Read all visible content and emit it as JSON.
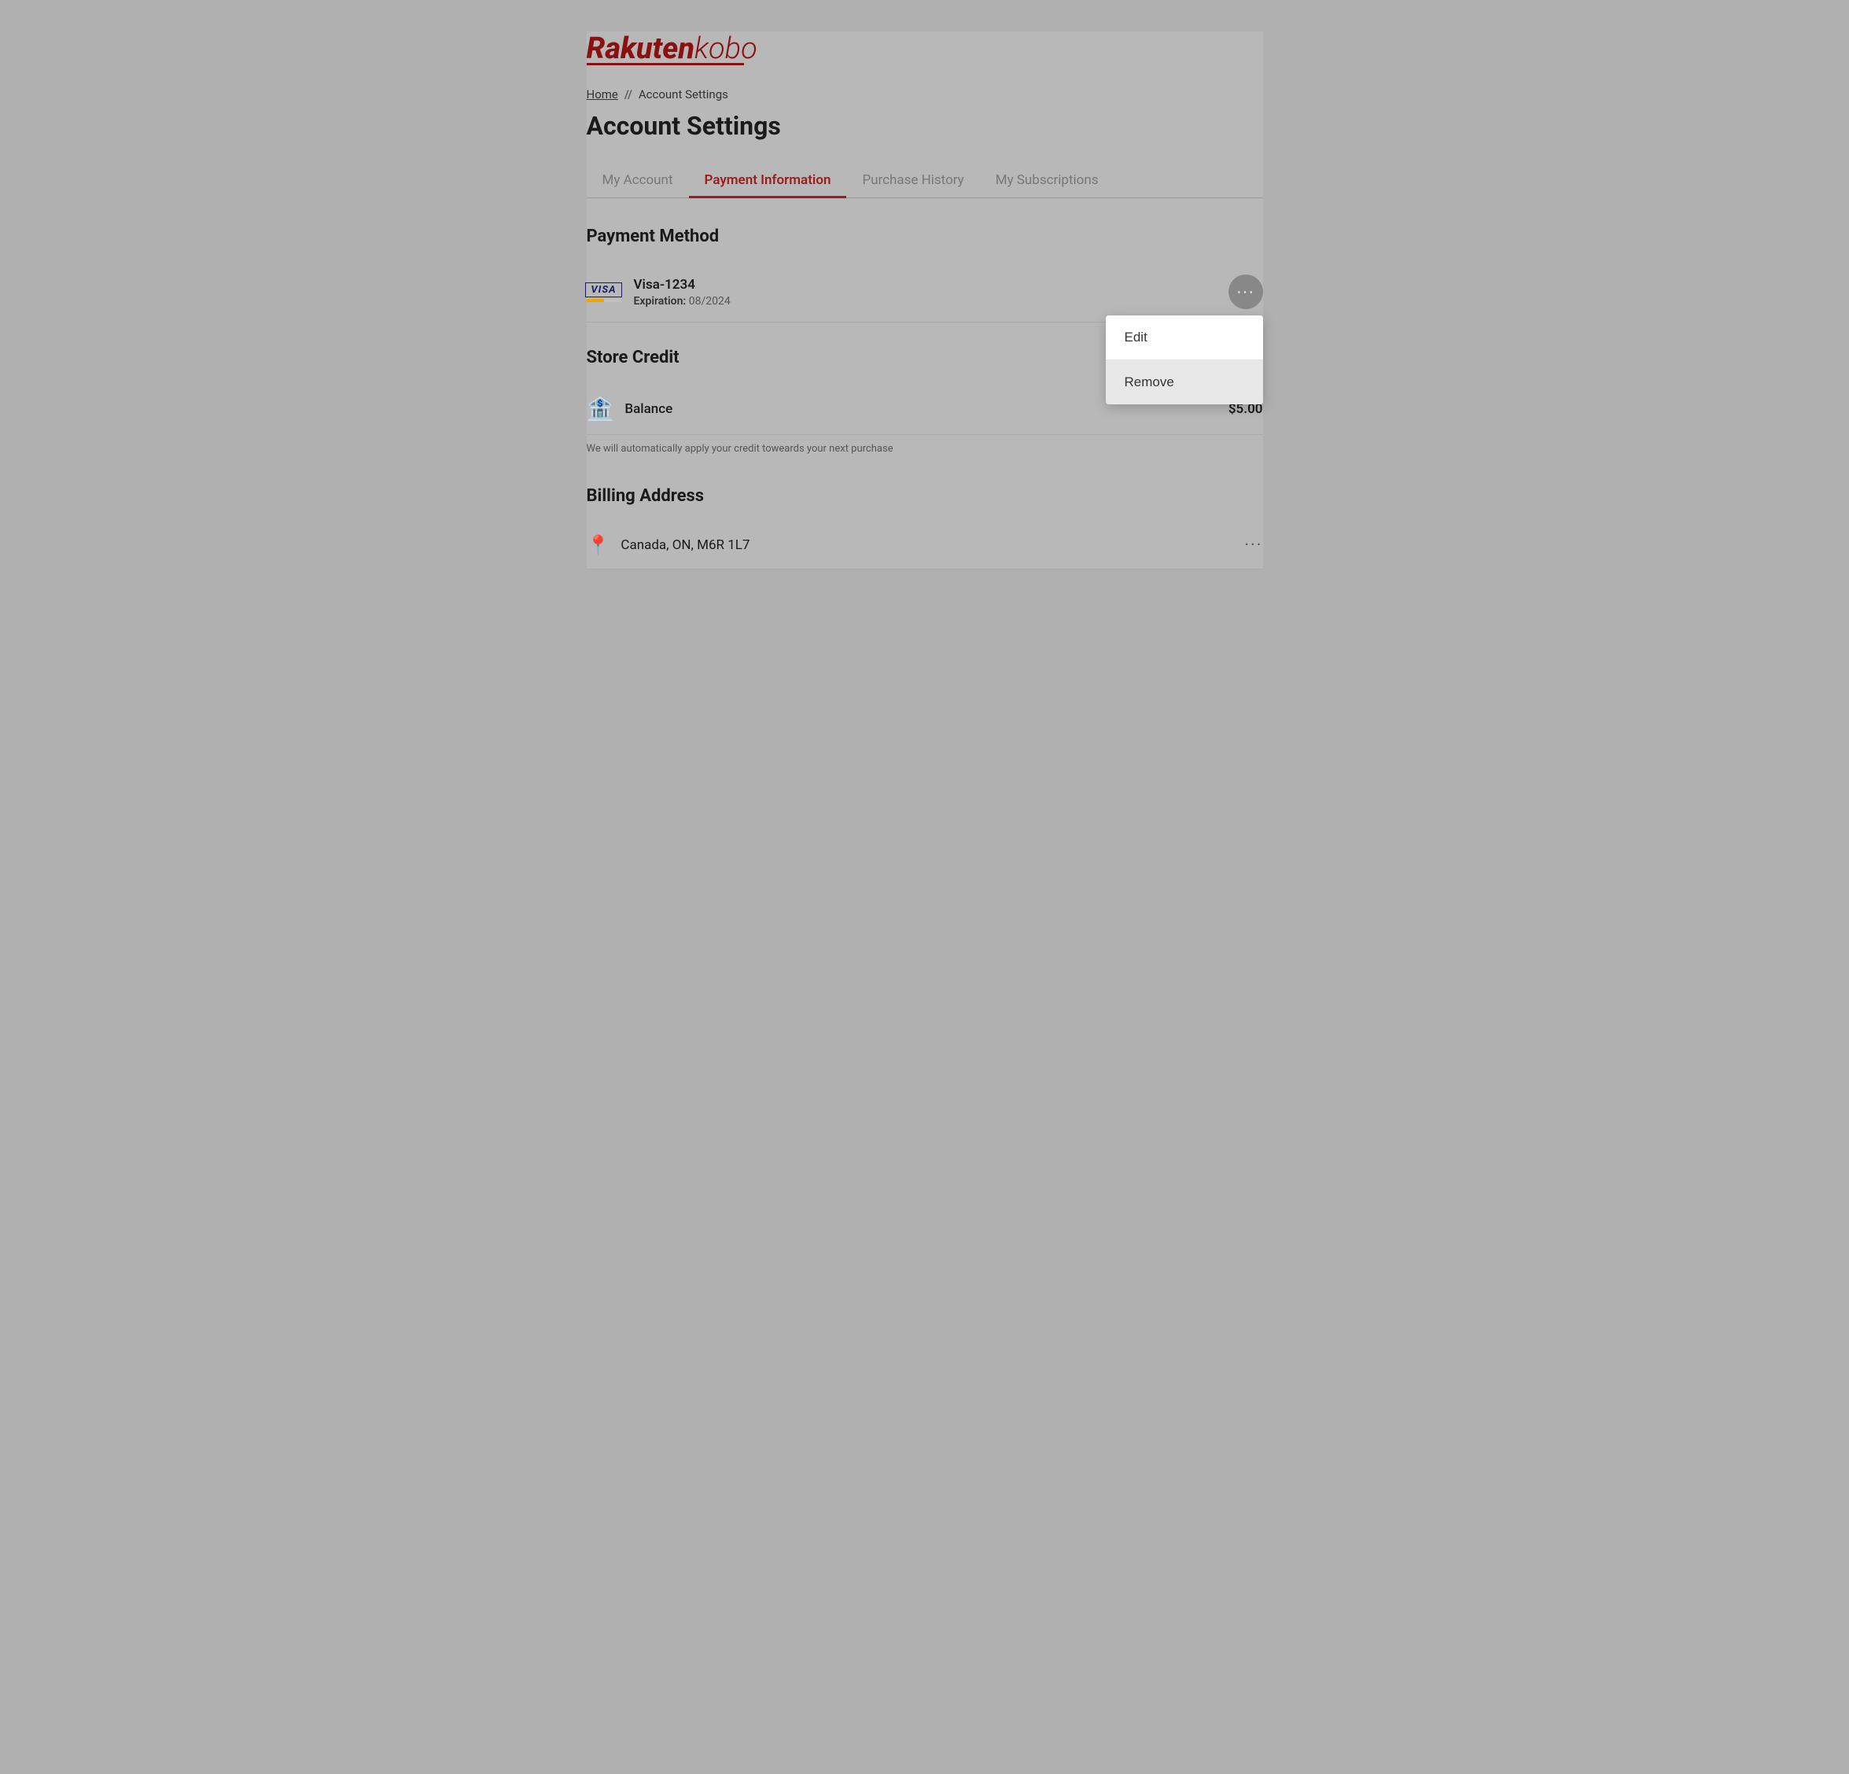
{
  "logo": {
    "rakuten": "Rakuten",
    "kobo": "kobo",
    "underline": true
  },
  "breadcrumb": {
    "home": "Home",
    "separator": "//",
    "current": "Account Settings"
  },
  "page": {
    "title": "Account Settings"
  },
  "tabs": [
    {
      "id": "my-account",
      "label": "My Account",
      "active": false
    },
    {
      "id": "payment-information",
      "label": "Payment Information",
      "active": true
    },
    {
      "id": "purchase-history",
      "label": "Purchase History",
      "active": false
    },
    {
      "id": "my-subscriptions",
      "label": "My Subscriptions",
      "active": false
    }
  ],
  "payment_method": {
    "section_title": "Payment Method",
    "card": {
      "name": "Visa-1234",
      "expiry_label": "Expiration:",
      "expiry_value": "08/2024"
    },
    "dropdown": {
      "edit": "Edit",
      "remove": "Remove"
    }
  },
  "store_credit": {
    "section_title": "Store Credit",
    "balance_label": "Balance",
    "balance_amount": "$5.00",
    "note": "We will automatically apply your credit toweards your next purchase"
  },
  "billing_address": {
    "section_title": "Billing Address",
    "address": "Canada, ON, M6R 1L7"
  }
}
